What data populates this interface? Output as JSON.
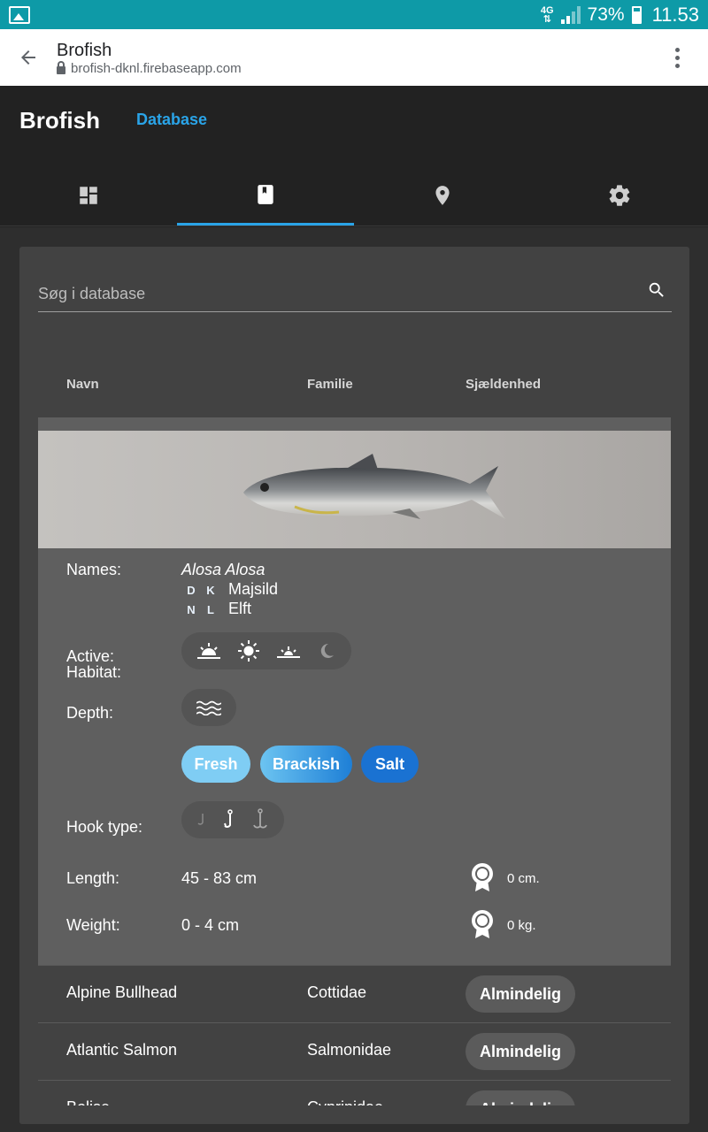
{
  "status_bar": {
    "network": "4G",
    "battery_percent": "73%",
    "time": "11.53"
  },
  "browser": {
    "page_title": "Brofish",
    "url": "brofish-dknl.firebaseapp.com"
  },
  "app": {
    "brand": "Brofish",
    "nav_link": "Database",
    "accent_color": "#2aa4e8",
    "tabs": [
      {
        "icon": "dashboard-icon",
        "active": false
      },
      {
        "icon": "book-icon",
        "active": true
      },
      {
        "icon": "location-pin-icon",
        "active": false
      },
      {
        "icon": "gear-icon",
        "active": false
      }
    ]
  },
  "search": {
    "placeholder": "Søg i database",
    "value": ""
  },
  "table": {
    "columns": [
      "Navn",
      "Familie",
      "Sjældenhed"
    ]
  },
  "detail": {
    "labels": {
      "names": "Names:",
      "active": "Active:",
      "depth": "Depth:",
      "habitat": "Habitat:",
      "hook_type": "Hook type:",
      "length": "Length:",
      "weight": "Weight:"
    },
    "latin_name": "Alosa Alosa",
    "local_names": [
      {
        "codes": [
          "D",
          "K"
        ],
        "name": "Majsild"
      },
      {
        "codes": [
          "N",
          "L"
        ],
        "name": "Elft"
      }
    ],
    "active_icons": [
      "sunrise-icon",
      "sun-icon",
      "sunset-icon",
      "moon-icon"
    ],
    "depth_icon": "water-surface-icon",
    "habitat": [
      "Fresh",
      "Brackish",
      "Salt"
    ],
    "hook_icons": [
      "small-hook-icon",
      "single-hook-icon",
      "treble-hook-icon"
    ],
    "length": "45 - 83 cm",
    "weight": "0 - 4 cm",
    "record_length": "0 cm.",
    "record_weight": "0 kg."
  },
  "rows": [
    {
      "name": "Alpine Bullhead",
      "family": "Cottidae",
      "rarity": "Almindelig"
    },
    {
      "name": "Atlantic Salmon",
      "family": "Salmonidae",
      "rarity": "Almindelig"
    },
    {
      "name": "Bolise",
      "family": "Cyprinidae",
      "rarity": "Almindelig"
    }
  ]
}
